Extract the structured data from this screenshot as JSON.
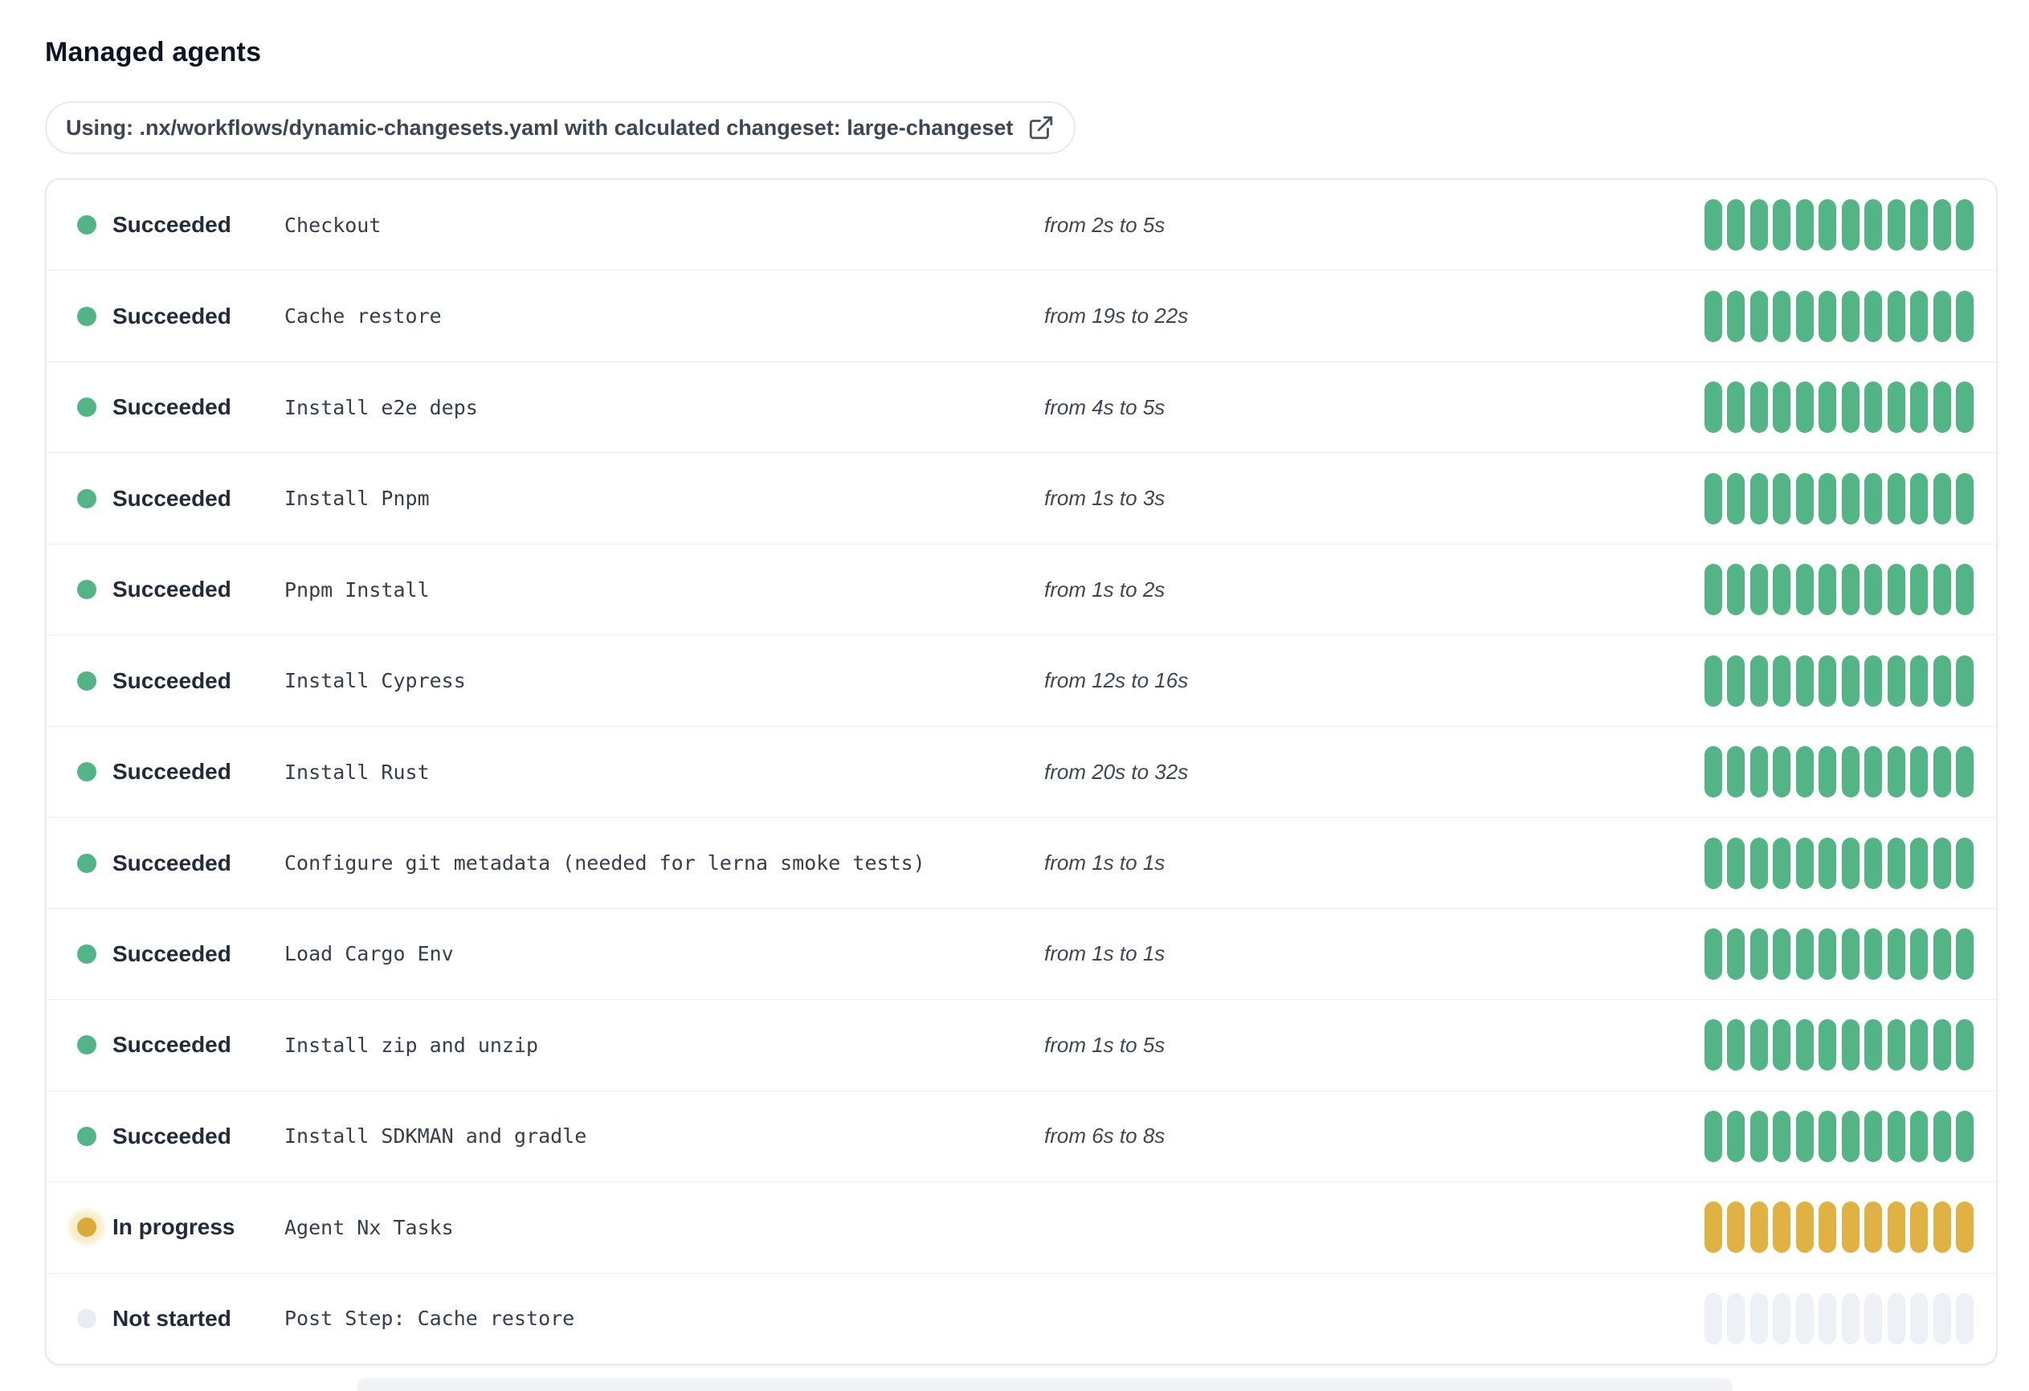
{
  "page": {
    "title": "Managed agents"
  },
  "banner": {
    "label": "Using: .nx/workflows/dynamic-changesets.yaml with calculated changeset: large-changeset",
    "icon": "external-link-icon"
  },
  "progress_bar": {
    "segments": 12
  },
  "status_colors": {
    "succeeded": "#53b586",
    "in_progress": "#e0b244",
    "in_progress_dot": "#dca93c",
    "not_started": "#edf1f6",
    "not_started_dot": "#e9edf3"
  },
  "agents": [
    {
      "status": "succeeded",
      "status_label": "Succeeded",
      "step": "Checkout",
      "duration": "from 2s to 5s"
    },
    {
      "status": "succeeded",
      "status_label": "Succeeded",
      "step": "Cache restore",
      "duration": "from 19s to 22s"
    },
    {
      "status": "succeeded",
      "status_label": "Succeeded",
      "step": "Install e2e deps",
      "duration": "from 4s to 5s"
    },
    {
      "status": "succeeded",
      "status_label": "Succeeded",
      "step": "Install Pnpm",
      "duration": "from 1s to 3s"
    },
    {
      "status": "succeeded",
      "status_label": "Succeeded",
      "step": "Pnpm Install",
      "duration": "from 1s to 2s"
    },
    {
      "status": "succeeded",
      "status_label": "Succeeded",
      "step": "Install Cypress",
      "duration": "from 12s to 16s"
    },
    {
      "status": "succeeded",
      "status_label": "Succeeded",
      "step": "Install Rust",
      "duration": "from 20s to 32s"
    },
    {
      "status": "succeeded",
      "status_label": "Succeeded",
      "step": "Configure git metadata (needed for lerna smoke tests)",
      "duration": "from 1s to 1s"
    },
    {
      "status": "succeeded",
      "status_label": "Succeeded",
      "step": "Load Cargo Env",
      "duration": "from 1s to 1s"
    },
    {
      "status": "succeeded",
      "status_label": "Succeeded",
      "step": "Install zip and unzip",
      "duration": "from 1s to 5s"
    },
    {
      "status": "succeeded",
      "status_label": "Succeeded",
      "step": "Install SDKMAN and gradle",
      "duration": "from 6s to 8s"
    },
    {
      "status": "in-progress",
      "status_label": "In progress",
      "step": "Agent Nx Tasks",
      "duration": ""
    },
    {
      "status": "not-started",
      "status_label": "Not started",
      "step": "Post Step: Cache restore",
      "duration": ""
    }
  ]
}
